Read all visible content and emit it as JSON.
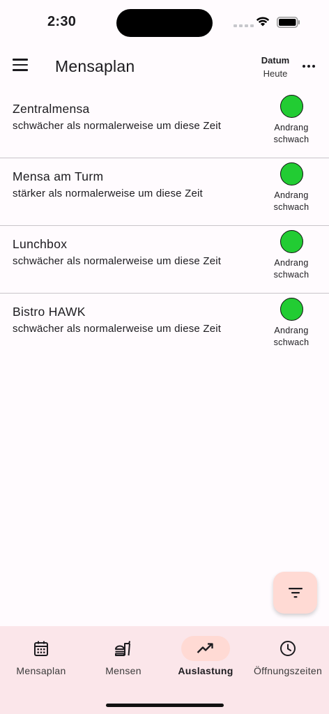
{
  "status_bar": {
    "time": "2:30"
  },
  "app_bar": {
    "title": "Mensaplan",
    "date_label": "Datum",
    "date_value": "Heute"
  },
  "canteens": [
    {
      "name": "Zentralmensa",
      "description": "schwächer als normalerweise um diese Zeit",
      "status_line1": "Andrang",
      "status_line2": "schwach",
      "status_color": "#22cc33"
    },
    {
      "name": "Mensa am Turm",
      "description": "stärker als normalerweise um diese Zeit",
      "status_line1": "Andrang",
      "status_line2": "schwach",
      "status_color": "#22cc33"
    },
    {
      "name": "Lunchbox",
      "description": "schwächer als normalerweise um diese Zeit",
      "status_line1": "Andrang",
      "status_line2": "schwach",
      "status_color": "#22cc33"
    },
    {
      "name": "Bistro HAWK",
      "description": "schwächer als normalerweise um diese Zeit",
      "status_line1": "Andrang",
      "status_line2": "schwach",
      "status_color": "#22cc33"
    }
  ],
  "fab": {
    "icon": "filter-icon"
  },
  "bottom_nav": {
    "items": [
      {
        "label": "Mensaplan",
        "icon": "calendar-icon",
        "active": false
      },
      {
        "label": "Mensen",
        "icon": "restaurant-icon",
        "active": false
      },
      {
        "label": "Auslastung",
        "icon": "trending-up-icon",
        "active": true
      },
      {
        "label": "Öffnungszeiten",
        "icon": "clock-icon",
        "active": false
      }
    ]
  },
  "colors": {
    "accent": "#ffdad4",
    "nav_background": "#fbe6ea",
    "background": "#fffbfe"
  }
}
